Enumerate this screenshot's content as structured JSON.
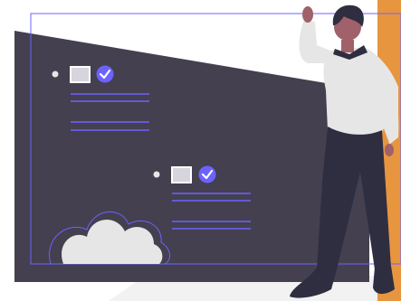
{
  "colors": {
    "background": "#ffffff",
    "board": "#44404f",
    "accent": "#6c63ff",
    "orange": "#e8953f",
    "skin": "#a0616a",
    "hair": "#2f2e41",
    "shirt": "#e6e6e6",
    "pants": "#2f2e41",
    "floor": "#f2f2f2",
    "checkbox_fill": "#d6d5de"
  },
  "scene": {
    "items": [
      {
        "id": "task-1",
        "checked": true,
        "text_lines": 2,
        "extra_lines": 2
      },
      {
        "id": "task-2",
        "checked": true,
        "text_lines": 2,
        "extra_lines": 2
      }
    ],
    "icons": [
      "check-circle-icon",
      "bush-icon"
    ]
  }
}
